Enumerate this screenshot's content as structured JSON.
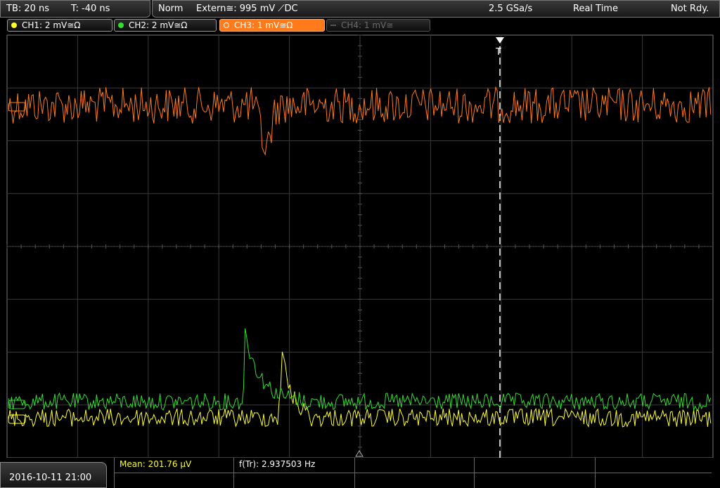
{
  "header": {
    "timebase": "TB: 20 ns",
    "trigger_time": "T: -40 ns",
    "mode": "Norm",
    "trigger_source": "Extern≅: 995 mV ⟋DC",
    "sample_rate": "2.5 GSa/s",
    "acq_mode": "Real Time",
    "status": "Not Rdy."
  },
  "channels": [
    {
      "label": "CH1: 2 mV≅Ω",
      "color": "#ffff33",
      "state": "on"
    },
    {
      "label": "CH2: 2 mV≅Ω",
      "color": "#33dd33",
      "state": "on"
    },
    {
      "label": "CH3: 1 mV≅Ω",
      "color": "#ff7a1a",
      "state": "active"
    },
    {
      "label": "CH4: 1 mV≅",
      "color": "#777777",
      "state": "off"
    }
  ],
  "trigger_marker": "T",
  "footer": {
    "datetime": "2016-10-11 21:00",
    "mean_label": "Mean: 201.76 µV",
    "freq_label": "f(Tr): 2.937503 Hz"
  },
  "colors": {
    "ch1": "#ffff33",
    "ch2": "#33dd33",
    "ch3": "#ff7a1a",
    "grid": "#444444",
    "trigger_line": "#ffffff"
  }
}
